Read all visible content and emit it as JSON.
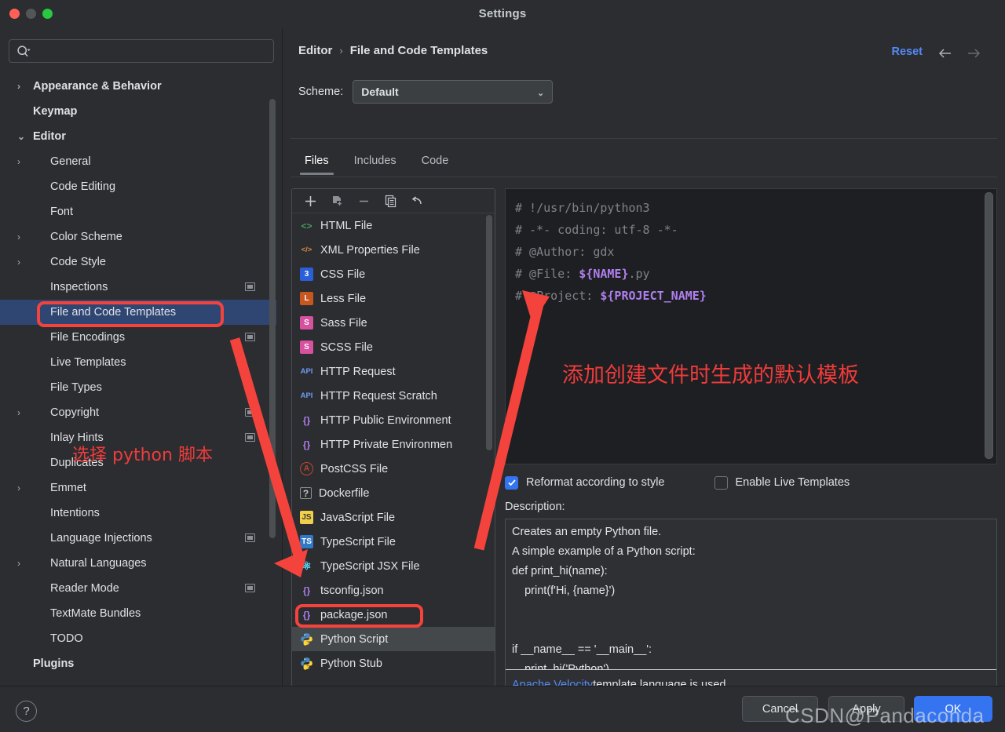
{
  "window": {
    "title": "Settings",
    "traffic_lights": [
      "close-red",
      "minimize-gray",
      "zoom-green"
    ]
  },
  "sidebar": {
    "search": {
      "value": "",
      "placeholder": "",
      "icon": "search-icon"
    },
    "items": [
      {
        "label": "Appearance & Behavior",
        "level": 0,
        "arrow": "›",
        "bold": true,
        "badge": false,
        "selected": false
      },
      {
        "label": "Keymap",
        "level": 0,
        "arrow": "",
        "bold": true,
        "badge": false,
        "selected": false
      },
      {
        "label": "Editor",
        "level": 0,
        "arrow": "⌄",
        "bold": true,
        "badge": false,
        "selected": false
      },
      {
        "label": "General",
        "level": 1,
        "arrow": "›",
        "bold": false,
        "badge": false,
        "selected": false
      },
      {
        "label": "Code Editing",
        "level": 1,
        "arrow": "",
        "bold": false,
        "badge": false,
        "selected": false
      },
      {
        "label": "Font",
        "level": 1,
        "arrow": "",
        "bold": false,
        "badge": false,
        "selected": false
      },
      {
        "label": "Color Scheme",
        "level": 1,
        "arrow": "›",
        "bold": false,
        "badge": false,
        "selected": false
      },
      {
        "label": "Code Style",
        "level": 1,
        "arrow": "›",
        "bold": false,
        "badge": false,
        "selected": false
      },
      {
        "label": "Inspections",
        "level": 1,
        "arrow": "",
        "bold": false,
        "badge": true,
        "selected": false
      },
      {
        "label": "File and Code Templates",
        "level": 1,
        "arrow": "",
        "bold": false,
        "badge": false,
        "selected": true
      },
      {
        "label": "File Encodings",
        "level": 1,
        "arrow": "",
        "bold": false,
        "badge": true,
        "selected": false
      },
      {
        "label": "Live Templates",
        "level": 1,
        "arrow": "",
        "bold": false,
        "badge": false,
        "selected": false
      },
      {
        "label": "File Types",
        "level": 1,
        "arrow": "",
        "bold": false,
        "badge": false,
        "selected": false
      },
      {
        "label": "Copyright",
        "level": 1,
        "arrow": "›",
        "bold": false,
        "badge": true,
        "selected": false
      },
      {
        "label": "Inlay Hints",
        "level": 1,
        "arrow": "",
        "bold": false,
        "badge": true,
        "selected": false
      },
      {
        "label": "Duplicates",
        "level": 1,
        "arrow": "",
        "bold": false,
        "badge": false,
        "selected": false
      },
      {
        "label": "Emmet",
        "level": 1,
        "arrow": "›",
        "bold": false,
        "badge": false,
        "selected": false
      },
      {
        "label": "Intentions",
        "level": 1,
        "arrow": "",
        "bold": false,
        "badge": false,
        "selected": false
      },
      {
        "label": "Language Injections",
        "level": 1,
        "arrow": "",
        "bold": false,
        "badge": true,
        "selected": false
      },
      {
        "label": "Natural Languages",
        "level": 1,
        "arrow": "›",
        "bold": false,
        "badge": false,
        "selected": false
      },
      {
        "label": "Reader Mode",
        "level": 1,
        "arrow": "",
        "bold": false,
        "badge": true,
        "selected": false
      },
      {
        "label": "TextMate Bundles",
        "level": 1,
        "arrow": "",
        "bold": false,
        "badge": false,
        "selected": false
      },
      {
        "label": "TODO",
        "level": 1,
        "arrow": "",
        "bold": false,
        "badge": false,
        "selected": false
      },
      {
        "label": "Plugins",
        "level": 0,
        "arrow": "",
        "bold": true,
        "badge": false,
        "selected": false
      }
    ]
  },
  "header": {
    "breadcrumb_root": "Editor",
    "breadcrumb_sep": "›",
    "breadcrumb_leaf": "File and Code Templates",
    "reset_label": "Reset",
    "back_icon": "arrow-left-icon",
    "forward_icon": "arrow-right-icon"
  },
  "scheme": {
    "label": "Scheme:",
    "value": "Default",
    "chevron": "⌄"
  },
  "tabs": [
    {
      "label": "Files",
      "active": true
    },
    {
      "label": "Includes",
      "active": false
    },
    {
      "label": "Code",
      "active": false
    }
  ],
  "list_toolbar": [
    {
      "name": "add-template-button",
      "glyph": "+"
    },
    {
      "name": "copy-template-button",
      "glyph": "⧉"
    },
    {
      "name": "remove-template-button",
      "glyph": "—"
    },
    {
      "name": "duplicate-template-button",
      "glyph": "❐"
    },
    {
      "name": "reset-template-button",
      "glyph": "↩"
    }
  ],
  "templates": [
    {
      "label": "HTML File",
      "icon": "html-icon",
      "icon_text": "<>",
      "fg": "#4a9b5e",
      "bg": "transparent",
      "selected": false
    },
    {
      "label": "XML Properties File",
      "icon": "xml-icon",
      "icon_text": "</>",
      "fg": "#d9864a",
      "bg": "transparent",
      "selected": false
    },
    {
      "label": "CSS File",
      "icon": "css-icon",
      "icon_text": "3",
      "fg": "#ffffff",
      "bg": "#2b5fd9",
      "selected": false
    },
    {
      "label": "Less File",
      "icon": "less-icon",
      "icon_text": "L",
      "fg": "#ffffff",
      "bg": "#c7561f",
      "selected": false
    },
    {
      "label": "Sass File",
      "icon": "sass-icon",
      "icon_text": "S",
      "fg": "#ffffff",
      "bg": "#d6519e",
      "selected": false
    },
    {
      "label": "SCSS File",
      "icon": "scss-icon",
      "icon_text": "S",
      "fg": "#ffffff",
      "bg": "#d6519e",
      "selected": false
    },
    {
      "label": "HTTP Request",
      "icon": "api-icon",
      "icon_text": "API",
      "fg": "#6b9bf5",
      "bg": "transparent",
      "selected": false
    },
    {
      "label": "HTTP Request Scratch",
      "icon": "api-icon",
      "icon_text": "API",
      "fg": "#6b9bf5",
      "bg": "transparent",
      "selected": false
    },
    {
      "label": "HTTP Public Environment",
      "icon": "json-icon",
      "icon_text": "{}",
      "fg": "#b07ff0",
      "bg": "transparent",
      "selected": false
    },
    {
      "label": "HTTP Private Environmen",
      "icon": "json-icon",
      "icon_text": "{}",
      "fg": "#b07ff0",
      "bg": "transparent",
      "selected": false
    },
    {
      "label": "PostCSS File",
      "icon": "postcss-icon",
      "icon_text": "Ⓐ",
      "fg": "#c2442e",
      "bg": "transparent",
      "selected": false
    },
    {
      "label": "Dockerfile",
      "icon": "dockerfile-icon",
      "icon_text": "?",
      "fg": "#c5c8cc",
      "bg": "transparent",
      "selected": false
    },
    {
      "label": "JavaScript File",
      "icon": "javascript-icon",
      "icon_text": "JS",
      "fg": "#3b3b2a",
      "bg": "#f0d04a",
      "selected": false
    },
    {
      "label": "TypeScript File",
      "icon": "typescript-icon",
      "icon_text": "TS",
      "fg": "#ffffff",
      "bg": "#3178c6",
      "selected": false
    },
    {
      "label": "TypeScript JSX File",
      "icon": "react-icon",
      "icon_text": "⚛",
      "fg": "#61dafb",
      "bg": "transparent",
      "selected": false
    },
    {
      "label": "tsconfig.json",
      "icon": "json-icon",
      "icon_text": "{}",
      "fg": "#b07ff0",
      "bg": "transparent",
      "selected": false
    },
    {
      "label": "package.json",
      "icon": "json-icon",
      "icon_text": "{}",
      "fg": "#b07ff0",
      "bg": "transparent",
      "selected": false
    },
    {
      "label": "Python Script",
      "icon": "python-icon",
      "icon_text": "ὀD",
      "fg": "#ffd43b",
      "bg": "transparent",
      "selected": true
    },
    {
      "label": "Python Stub",
      "icon": "python-icon",
      "icon_text": "ὀD",
      "fg": "#ffd43b",
      "bg": "transparent",
      "selected": false
    }
  ],
  "editor": {
    "lines": [
      [
        {
          "t": "# !/usr/bin/python3",
          "k": "c"
        }
      ],
      [
        {
          "t": "# -*- coding: utf-8 -*-",
          "k": "c"
        }
      ],
      [
        {
          "t": "# @Author: gdx",
          "k": "c"
        }
      ],
      [
        {
          "t": "# @File: ",
          "k": "c"
        },
        {
          "t": "${NAME}",
          "k": "v"
        },
        {
          "t": ".py",
          "k": "c"
        }
      ],
      [
        {
          "t": "# @Project: ",
          "k": "c"
        },
        {
          "t": "${PROJECT_NAME}",
          "k": "v"
        }
      ]
    ]
  },
  "options": {
    "reformat": {
      "label": "Reformat according to style",
      "checked": true,
      "check_glyph": "✓"
    },
    "live_templates": {
      "label": "Enable Live Templates",
      "checked": false
    }
  },
  "description": {
    "label": "Description:",
    "body": "Creates an empty Python file.\nA simple example of a Python script:\ndef print_hi(name):\n    print(f'Hi, {name}')\n\n\nif __name__ == '__main__':\n    print_hi('Python')",
    "footer_link": "Apache Velocity",
    "footer_rest": " template language is used"
  },
  "footer": {
    "help_glyph": "?",
    "cancel_label": "Cancel",
    "apply_label": "Apply",
    "ok_label": "OK"
  },
  "annotations": {
    "text_cn_template": "添加创建文件时生成的默认模板",
    "text_cn_select": "选择 python 脚本",
    "color": "#ef3b3b"
  },
  "watermark": {
    "text": "CSDN@Pandaconda"
  }
}
